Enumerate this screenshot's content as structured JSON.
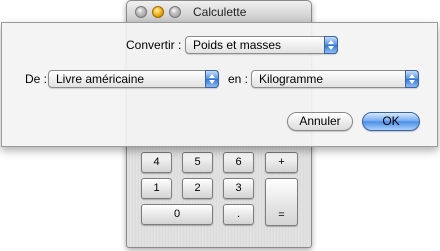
{
  "calculator": {
    "title": "Calculette",
    "keys_row1": [
      "4",
      "5",
      "6",
      "+"
    ],
    "keys_row2": [
      "1",
      "2",
      "3"
    ],
    "keys_row3": [
      "0",
      "."
    ],
    "equals": "="
  },
  "sheet": {
    "convert_label": "Convertir :",
    "convert_value": "Poids et masses",
    "from_label": "De :",
    "from_value": "Livre américaine",
    "to_label": "en :",
    "to_value": "Kilogramme",
    "cancel_label": "Annuler",
    "ok_label": "OK"
  }
}
